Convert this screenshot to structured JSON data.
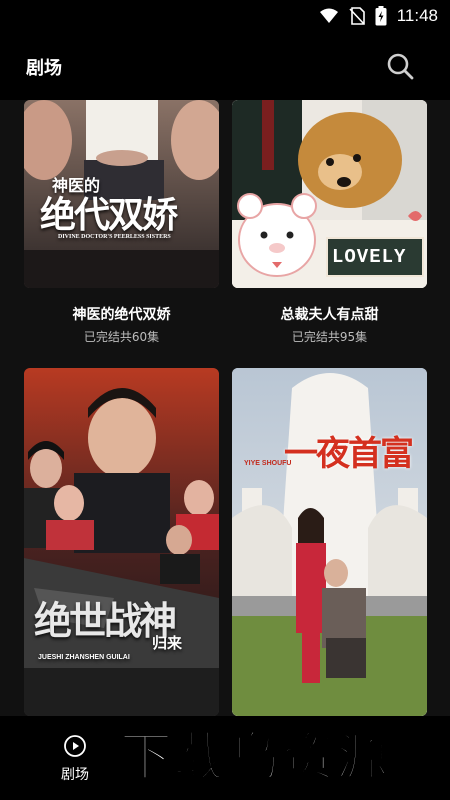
{
  "status_bar": {
    "time": "11:48",
    "icons": [
      "wifi-icon",
      "no-sim-icon",
      "battery-icon"
    ]
  },
  "header": {
    "title": "剧场",
    "search_icon": "search-icon"
  },
  "dramas": [
    {
      "title": "神医的绝代双娇",
      "status": "已完结共60集",
      "poster_title_top": "神医的",
      "poster_title_main": "绝代双娇",
      "poster_subtitle": "DIVINE DOCTOR'S PEERLESS SISTERS"
    },
    {
      "title": "总裁夫人有点甜",
      "status": "已完结共95集",
      "poster_label": "LOVELY"
    },
    {
      "title": "",
      "status": "",
      "poster_title_main": "绝世战神",
      "poster_title_sub": "归来",
      "poster_subtitle": "JUESHI ZHANSHEN GUILAI"
    },
    {
      "title": "",
      "status": "",
      "poster_title_main": "一夜首富",
      "poster_subtitle": "YIYE SHOUFU"
    }
  ],
  "bottom_nav": {
    "items": [
      {
        "label": "剧场",
        "icon": "play-circle-icon"
      }
    ]
  },
  "watermark": "下载鸟资源",
  "colors": {
    "background": "#000000",
    "content_bg": "#111111",
    "subtext": "#bdbdbd"
  }
}
